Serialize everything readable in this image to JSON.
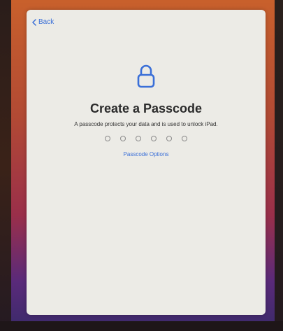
{
  "nav": {
    "back_label": "Back"
  },
  "header": {
    "icon": "lock-icon",
    "title": "Create a Passcode",
    "subtitle": "A passcode protects your data and is used to unlock iPad."
  },
  "passcode": {
    "digits": 6,
    "entered": 0
  },
  "options_link": "Passcode Options",
  "colors": {
    "accent": "#3a6fd8",
    "sheet": "#ecebe6",
    "title": "#2b2b2b"
  }
}
